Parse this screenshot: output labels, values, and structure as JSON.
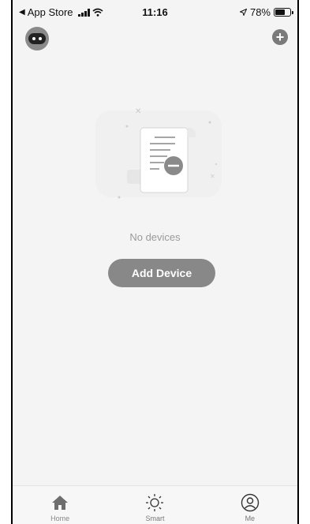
{
  "status_bar": {
    "back_label": "App Store",
    "time": "11:16",
    "battery_percent": "78%",
    "battery_level": 0.78
  },
  "header": {
    "avatar_icon": "robot-avatar-icon",
    "add_icon": "plus-circle-icon"
  },
  "empty_state": {
    "illustration_icon": "document-remove-illustration",
    "message": "No devices",
    "button_label": "Add Device"
  },
  "tabbar": {
    "tabs": [
      {
        "label": "Home",
        "icon": "home-icon",
        "active": true
      },
      {
        "label": "Smart",
        "icon": "sun-icon",
        "active": false
      },
      {
        "label": "Me",
        "icon": "user-icon",
        "active": false
      }
    ]
  },
  "colors": {
    "background": "#f4f4f4",
    "button": "#888888",
    "muted_text": "#9a9a9a"
  }
}
